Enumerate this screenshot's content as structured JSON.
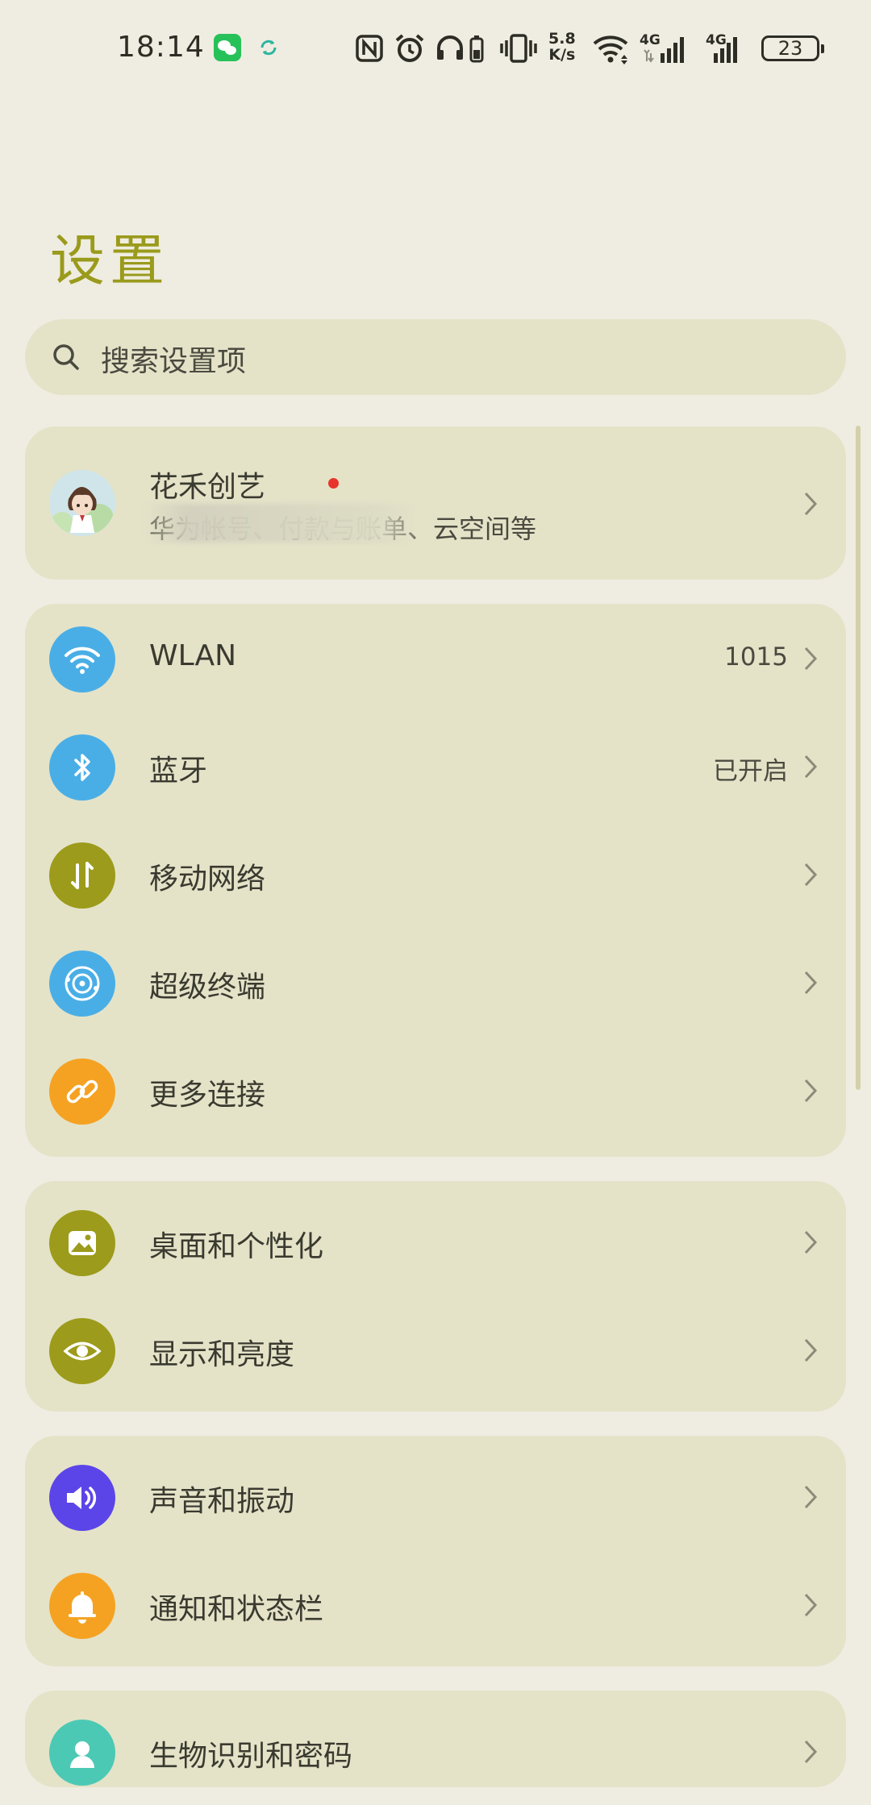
{
  "status_bar": {
    "time": "18:14",
    "network_speed_top": "5.8",
    "network_speed_bottom": "K/s",
    "signal1_label": "4G",
    "signal2_label": "4G",
    "battery": "23",
    "icons": [
      "wechat-icon",
      "sync-icon",
      "nfc-icon",
      "alarm-icon",
      "headphone-battery-icon",
      "vibrate-icon",
      "wifi-icon",
      "signal-icon",
      "signal-icon",
      "battery-icon"
    ]
  },
  "page": {
    "title": "设置"
  },
  "search": {
    "placeholder": "搜索设置项"
  },
  "account": {
    "name": "花禾创艺",
    "subtitle": "华为帐号、付款与账单、云空间等"
  },
  "network_group": [
    {
      "label": "WLAN",
      "value": "1015",
      "icon": "wifi-icon",
      "color": "#4aaee6"
    },
    {
      "label": "蓝牙",
      "value": "已开启",
      "icon": "bluetooth-icon",
      "color": "#4aaee6"
    },
    {
      "label": "移动网络",
      "value": "",
      "icon": "mobile-data-icon",
      "color": "#9c9b1b"
    },
    {
      "label": "超级终端",
      "value": "",
      "icon": "super-device-icon",
      "color": "#4aaee6"
    },
    {
      "label": "更多连接",
      "value": "",
      "icon": "link-icon",
      "color": "#f5a223"
    }
  ],
  "display_group": [
    {
      "label": "桌面和个性化",
      "icon": "wallpaper-icon",
      "color": "#9c9b1b"
    },
    {
      "label": "显示和亮度",
      "icon": "eye-icon",
      "color": "#9c9b1b"
    }
  ],
  "sound_group": [
    {
      "label": "声音和振动",
      "icon": "speaker-icon",
      "color": "#5b45e8"
    },
    {
      "label": "通知和状态栏",
      "icon": "bell-icon",
      "color": "#f5a223"
    }
  ],
  "partial_group": [
    {
      "label": "生物识别和密码",
      "icon": "biometric-icon",
      "color": "#4cc9b4"
    }
  ]
}
